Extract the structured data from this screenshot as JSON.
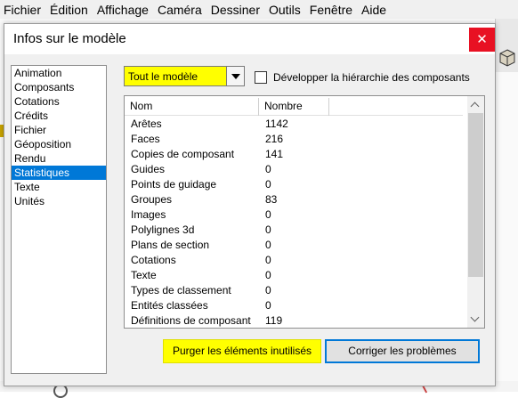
{
  "menu": [
    "Fichier",
    "Édition",
    "Affichage",
    "Caméra",
    "Dessiner",
    "Outils",
    "Fenêtre",
    "Aide"
  ],
  "dialog": {
    "title": "Infos sur le modèle",
    "close_glyph": "✕",
    "categories": [
      "Animation",
      "Composants",
      "Cotations",
      "Crédits",
      "Fichier",
      "Géoposition",
      "Rendu",
      "Statistiques",
      "Texte",
      "Unités"
    ],
    "selected_category": "Statistiques",
    "scope": {
      "value": "Tout le modèle"
    },
    "expand_checkbox": {
      "label": "Développer la hiérarchie des composants",
      "checked": false
    },
    "table": {
      "headers": [
        "Nom",
        "Nombre"
      ],
      "rows": [
        {
          "name": "Arêtes",
          "count": "1142"
        },
        {
          "name": "Faces",
          "count": "216"
        },
        {
          "name": "Copies de composant",
          "count": "141"
        },
        {
          "name": "Guides",
          "count": "0"
        },
        {
          "name": "Points de guidage",
          "count": "0"
        },
        {
          "name": "Groupes",
          "count": "83"
        },
        {
          "name": "Images",
          "count": "0"
        },
        {
          "name": "Polylignes 3d",
          "count": "0"
        },
        {
          "name": "Plans de section",
          "count": "0"
        },
        {
          "name": "Cotations",
          "count": "0"
        },
        {
          "name": "Texte",
          "count": "0"
        },
        {
          "name": "Types de classement",
          "count": "0"
        },
        {
          "name": "Entités classées",
          "count": "0"
        },
        {
          "name": "Définitions de composant",
          "count": "119"
        }
      ]
    },
    "buttons": {
      "purge": "Purger les éléments inutilisés",
      "fix": "Corriger les problèmes"
    },
    "highlight_color": "#ffff00",
    "selection_color": "#0078d7"
  }
}
